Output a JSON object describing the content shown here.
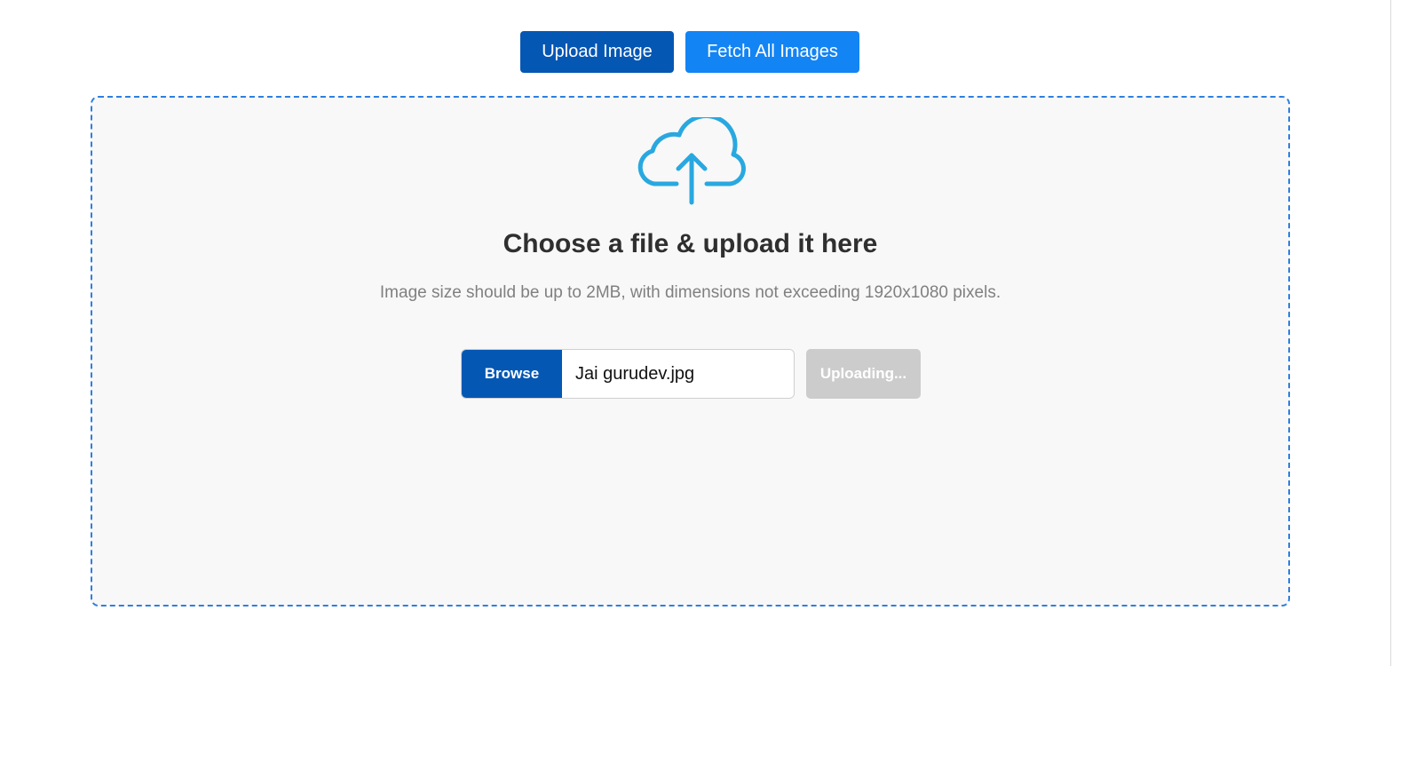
{
  "toolbar": {
    "upload_label": "Upload Image",
    "fetch_label": "Fetch All Images"
  },
  "dropzone": {
    "icon": "cloud-upload-icon",
    "title": "Choose a file & upload it here",
    "subtitle": "Image size should be up to 2MB, with dimensions not exceeding 1920x1080 pixels.",
    "browse_label": "Browse",
    "file_name": "Jai gurudev.jpg",
    "upload_status_label": "Uploading..."
  },
  "colors": {
    "primary_dark": "#0557b4",
    "primary": "#1384f4",
    "border_dashed": "#2e7fe0",
    "icon": "#29a8e0",
    "disabled": "#cccccc"
  }
}
